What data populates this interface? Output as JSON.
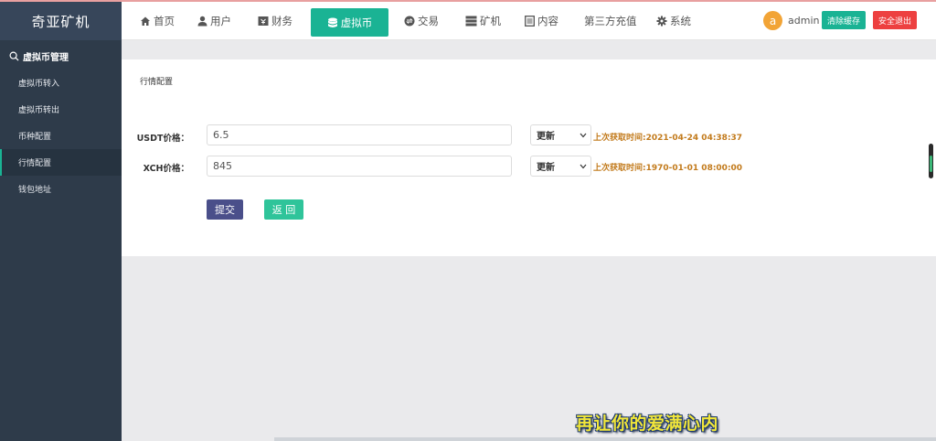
{
  "sidebar": {
    "logo": "奇亚矿机",
    "group_title": "虚拟币管理",
    "items": [
      {
        "label": "虚拟币转入"
      },
      {
        "label": "虚拟币转出"
      },
      {
        "label": "币种配置"
      },
      {
        "label": "行情配置",
        "active": true
      },
      {
        "label": "钱包地址"
      }
    ]
  },
  "topnav": {
    "items": [
      {
        "label": "首页",
        "icon": "home-icon"
      },
      {
        "label": "用户",
        "icon": "user-icon"
      },
      {
        "label": "财务",
        "icon": "finance-icon"
      },
      {
        "label": "虚拟币",
        "icon": "database-icon",
        "active": true
      },
      {
        "label": "交易",
        "icon": "exchange-icon"
      },
      {
        "label": "矿机",
        "icon": "server-icon"
      },
      {
        "label": "内容",
        "icon": "document-icon"
      },
      {
        "label": "第三方充值",
        "icon": ""
      },
      {
        "label": "系统",
        "icon": "gear-icon"
      }
    ],
    "avatar_letter": "a",
    "username": "admin",
    "clear_cache": "清除缓存",
    "logout": "安全退出"
  },
  "main": {
    "section_title": "行情配置",
    "rows": [
      {
        "label": "USDT价格：",
        "value": "6.5",
        "select": "更新",
        "hint": "上次获取时间:2021-04-24 04:38:37"
      },
      {
        "label": "XCH价格：",
        "value": "845",
        "select": "更新",
        "hint": "上次获取时间:1970-01-01 08:00:00"
      }
    ],
    "submit": "提交",
    "back": "返 回"
  },
  "overlay": {
    "caption": "再让你的爱满心内"
  },
  "colors": {
    "sidebar_bg": "#2e3b4a",
    "accent": "#1ab394",
    "submit_bg": "#4a4f8a",
    "back_bg": "#2fc49a",
    "logout_bg": "#ed4040",
    "hint_text": "#c27a1b"
  }
}
